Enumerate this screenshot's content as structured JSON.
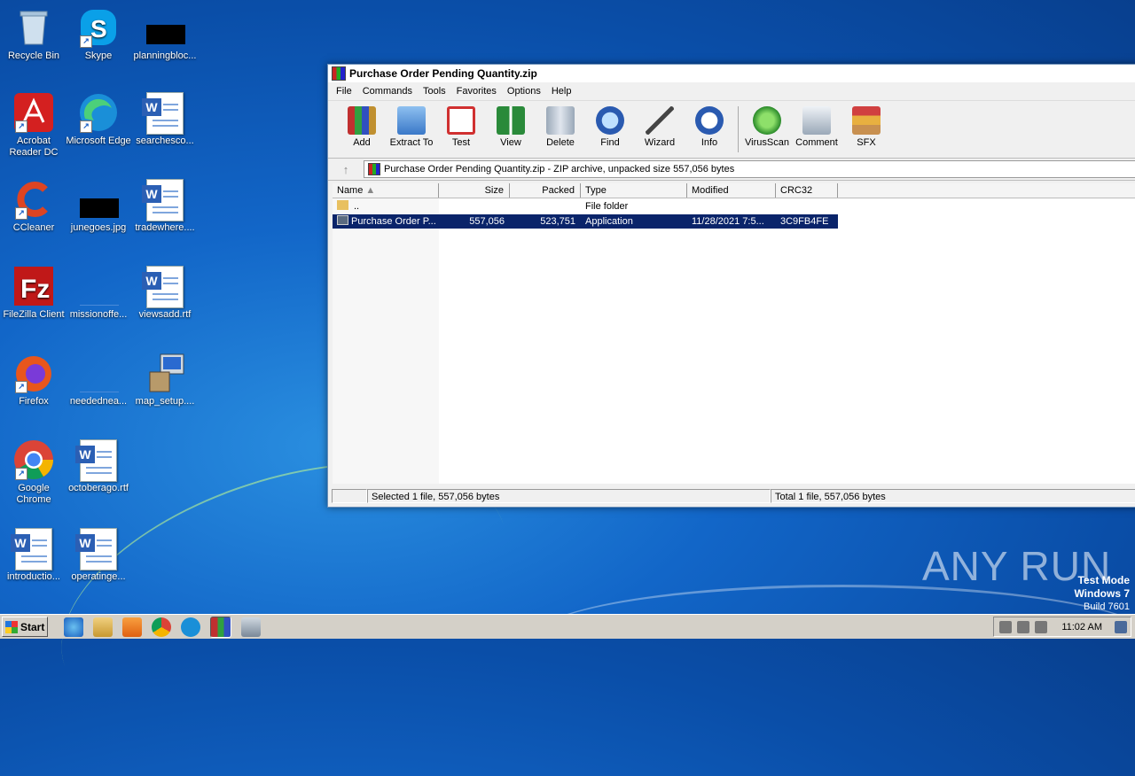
{
  "desktop": {
    "icons": [
      {
        "label": "Recycle Bin",
        "icon": "recycle-bin-icon"
      },
      {
        "label": "Skype",
        "icon": "skype-icon"
      },
      {
        "label": "planningbloc...",
        "icon": "redacted-image-icon"
      },
      {
        "label": "Acrobat Reader DC",
        "icon": "acrobat-icon"
      },
      {
        "label": "Microsoft Edge",
        "icon": "edge-icon"
      },
      {
        "label": "searchesco...",
        "icon": "word-doc-icon"
      },
      {
        "label": "CCleaner",
        "icon": "ccleaner-icon"
      },
      {
        "label": "junegoes.jpg",
        "icon": "redacted-image-icon"
      },
      {
        "label": "tradewhere....",
        "icon": "word-doc-icon"
      },
      {
        "label": "FileZilla Client",
        "icon": "filezilla-icon"
      },
      {
        "label": "missionoffe...",
        "icon": "blank-file-icon"
      },
      {
        "label": "viewsadd.rtf",
        "icon": "word-doc-icon"
      },
      {
        "label": "Firefox",
        "icon": "firefox-icon"
      },
      {
        "label": "neededneа...",
        "icon": "blank-file-icon"
      },
      {
        "label": "map_setup....",
        "icon": "installer-icon"
      },
      {
        "label": "Google Chrome",
        "icon": "chrome-icon"
      },
      {
        "label": "octoberago.rtf",
        "icon": "word-doc-icon"
      },
      {
        "label": "introductio...",
        "icon": "word-doc-icon"
      },
      {
        "label": "operatinge...",
        "icon": "word-doc-icon"
      }
    ]
  },
  "window": {
    "title": "Purchase Order Pending Quantity.zip",
    "menu": [
      "File",
      "Commands",
      "Tools",
      "Favorites",
      "Options",
      "Help"
    ],
    "toolbar": [
      {
        "label": "Add",
        "icon": "add-archive-icon",
        "color": "#c94a3a"
      },
      {
        "label": "Extract To",
        "icon": "extract-folder-icon",
        "color": "#4a88c9"
      },
      {
        "label": "Test",
        "icon": "test-checklist-icon",
        "color": "#d04040"
      },
      {
        "label": "View",
        "icon": "view-book-icon",
        "color": "#3a9a4a"
      },
      {
        "label": "Delete",
        "icon": "trash-icon",
        "color": "#8a98a8"
      },
      {
        "label": "Find",
        "icon": "magnifier-icon",
        "color": "#3a6ec0"
      },
      {
        "label": "Wizard",
        "icon": "wand-icon",
        "color": "#9ab8d8"
      },
      {
        "label": "Info",
        "icon": "info-icon",
        "color": "#2a5ab0"
      },
      {
        "label": "VirusScan",
        "icon": "virus-scan-icon",
        "color": "#3aa83a"
      },
      {
        "label": "Comment",
        "icon": "comment-icon",
        "color": "#7a8898"
      },
      {
        "label": "SFX",
        "icon": "sfx-icon",
        "color": "#d89a3a"
      }
    ],
    "address": "Purchase Order Pending Quantity.zip - ZIP archive, unpacked size 557,056 bytes",
    "columns": [
      "Name",
      "Size",
      "Packed",
      "Type",
      "Modified",
      "CRC32"
    ],
    "rows": [
      {
        "name": "..",
        "size": "",
        "packed": "",
        "type": "File folder",
        "modified": "",
        "crc": ""
      },
      {
        "name": "Purchase Order P...",
        "size": "557,056",
        "packed": "523,751",
        "type": "Application",
        "modified": "11/28/2021 7:5...",
        "crc": "3C9FB4FE"
      }
    ],
    "status_left": "Selected 1 file, 557,056 bytes",
    "status_right": "Total 1 file, 557,056 bytes"
  },
  "taskbar": {
    "start_label": "Start",
    "clock": "11:02 AM"
  },
  "watermark": "ANY RUN",
  "testmode": {
    "line1": "Test Mode",
    "line2": "Windows 7",
    "line3": "Build 7601"
  }
}
